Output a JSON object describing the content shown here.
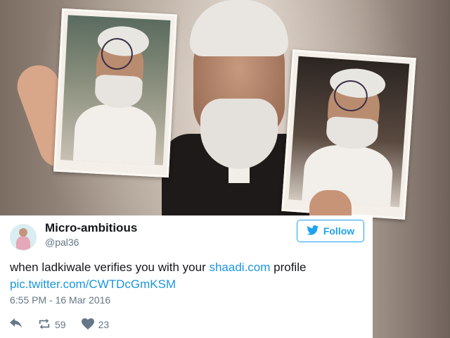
{
  "tweet": {
    "display_name": "Micro-ambitious",
    "handle": "@pal36",
    "follow_label": "Follow",
    "text_prefix": "when ladkiwale verifies you with your ",
    "text_link": "shaadi.com",
    "text_suffix": " profile",
    "pic_link": "pic.twitter.com/CWTDcGmKSM",
    "timestamp": "6:55 PM - 16 Mar 2016",
    "retweets": "59",
    "likes": "23"
  },
  "colors": {
    "accent": "#1da1f2",
    "link": "#1b95e0",
    "text": "#14171a",
    "muted": "#657786"
  },
  "icons": {
    "reply": "reply-icon",
    "retweet": "retweet-icon",
    "like": "heart-icon",
    "follow": "bird-icon"
  }
}
